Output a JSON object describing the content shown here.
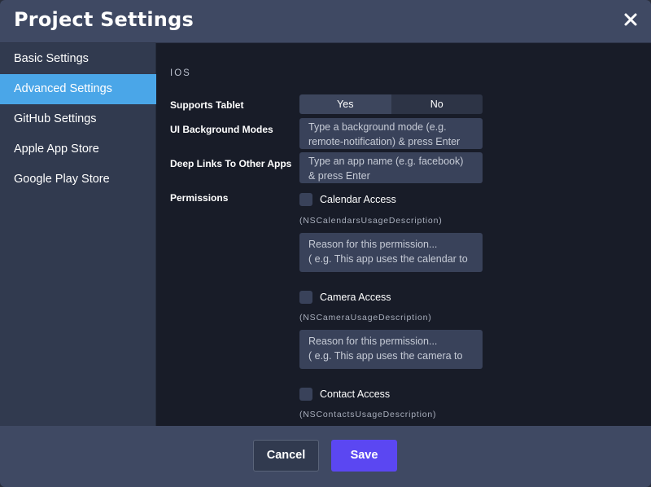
{
  "header": {
    "title": "Project Settings",
    "close_icon": "close-icon"
  },
  "sidebar": {
    "items": [
      {
        "label": "Basic Settings",
        "active": false
      },
      {
        "label": "Advanced Settings",
        "active": true
      },
      {
        "label": "GitHub Settings",
        "active": false
      },
      {
        "label": "Apple App Store",
        "active": false
      },
      {
        "label": "Google Play Store",
        "active": false
      }
    ]
  },
  "content": {
    "section_title": "IOS",
    "supports_tablet": {
      "label": "Supports Tablet",
      "yes": "Yes",
      "no": "No",
      "selected": "No"
    },
    "background_modes": {
      "label": "UI Background Modes",
      "placeholder_line1": "Type a background mode (e.g.",
      "placeholder_line2": "remote-notification) & press Enter"
    },
    "deep_links": {
      "label": "Deep Links To Other Apps",
      "placeholder_line1": "Type an app name (e.g. facebook)",
      "placeholder_line2": "& press Enter"
    },
    "permissions": {
      "label": "Permissions",
      "items": [
        {
          "label": "Calendar Access",
          "key": "(NSCalendarsUsageDescription)",
          "reason_line1": "Reason for this permission...",
          "reason_line2": "( e.g. This app uses the calendar to",
          "checked": false
        },
        {
          "label": "Camera Access",
          "key": "(NSCameraUsageDescription)",
          "reason_line1": "Reason for this permission...",
          "reason_line2": "( e.g. This app uses the camera to",
          "checked": false
        },
        {
          "label": "Contact Access",
          "key": "(NSContactsUsageDescription)",
          "checked": false
        }
      ]
    }
  },
  "footer": {
    "cancel_label": "Cancel",
    "save_label": "Save"
  },
  "colors": {
    "accent": "#4aa6e8",
    "save_button": "#5b47f2",
    "header_bg": "#3f4963",
    "content_bg": "#181c28",
    "sidebar_bg": "#313a4f"
  }
}
